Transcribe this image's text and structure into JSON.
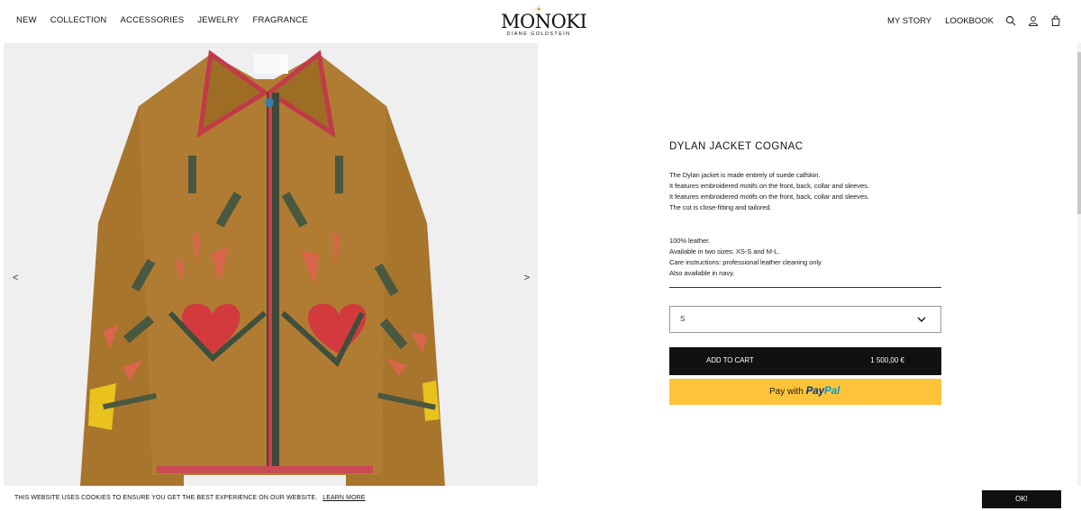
{
  "nav": {
    "left": [
      "NEW",
      "COLLECTION",
      "ACCESSORIES",
      "JEWELRY",
      "FRAGRANCE"
    ],
    "right": [
      "MY STORY",
      "LOOKBOOK"
    ],
    "icons": [
      "search-icon",
      "account-icon",
      "bag-icon"
    ]
  },
  "logo": {
    "brand": "MONOKI",
    "sub": "DIANE GOLDSTEIN"
  },
  "gallery": {
    "prev": "<",
    "next": ">"
  },
  "product": {
    "title": "DYLAN JACKET COGNAC",
    "description": [
      "The Dylan jacket is made entirely of suede calfskin.",
      "It features embroidered motifs on the front, back, collar and sleeves.",
      "It features embroidered motifs on the front, back, collar and sleeves.",
      "The cut is close-fitting and tailored."
    ],
    "details": [
      "100% leather.",
      "Available in two sizes: XS-S and M-L.",
      "Care instructions: professional leather cleaning only.",
      "Also available in navy."
    ],
    "size_selected": "S",
    "add_to_cart": "ADD TO CART",
    "price": "1 500,00 €",
    "paypal_prefix": "Pay with",
    "paypal_pay": "Pay",
    "paypal_pal": "Pal"
  },
  "cookie": {
    "message": "THIS WEBSITE USES COOKIES TO ENSURE YOU GET THE BEST EXPERIENCE ON OUR WEBSITE.",
    "learn_more": "LEARN MORE",
    "ok": "OK!"
  },
  "colors": {
    "accent": "#111111",
    "paypal_bg": "#ffc439",
    "jacket": "#a8752d"
  }
}
